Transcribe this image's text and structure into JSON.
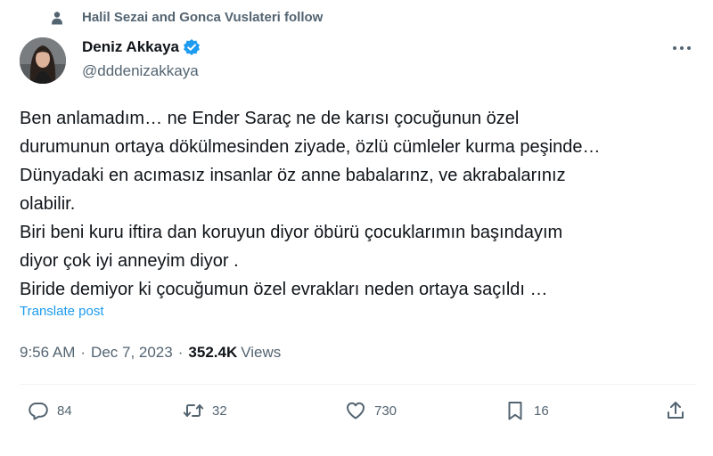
{
  "social_context": {
    "text": "Halil Sezai and Gonca Vuslateri follow",
    "icon": "person-icon"
  },
  "author": {
    "name": "Deniz Akkaya",
    "handle": "@dddenizakkaya",
    "verified_icon": "verified-badge-icon",
    "verified_color": "#1d9bf0"
  },
  "tweet": {
    "lines": [
      "Ben anlamadım… ne Ender Saraç ne de karısı çocuğunun özel",
      "durumunun ortaya dökülmesinden ziyade, özlü cümleler kurma peşinde…",
      "Dünyadaki en acımasız insanlar öz anne babalarınz, ve akrabalarınız",
      "olabilir.",
      "Biri beni kuru iftira dan koruyun diyor öbürü çocuklarımın başındayım",
      "diyor çok iyi anneyim diyor .",
      "Biride demiyor ki çocuğumun özel evrakları neden ortaya saçıldı …"
    ],
    "translate_label": "Translate post"
  },
  "meta": {
    "time": "9:56 AM",
    "separator": "·",
    "date": "Dec 7, 2023",
    "views_count": "352.4K",
    "views_label": "Views"
  },
  "actions": {
    "reply_count": "84",
    "retweet_count": "32",
    "like_count": "730",
    "bookmark_count": "16"
  },
  "colors": {
    "text_primary": "#0f1419",
    "text_secondary": "#536471",
    "link": "#1d9bf0",
    "divider": "#eff3f4"
  }
}
